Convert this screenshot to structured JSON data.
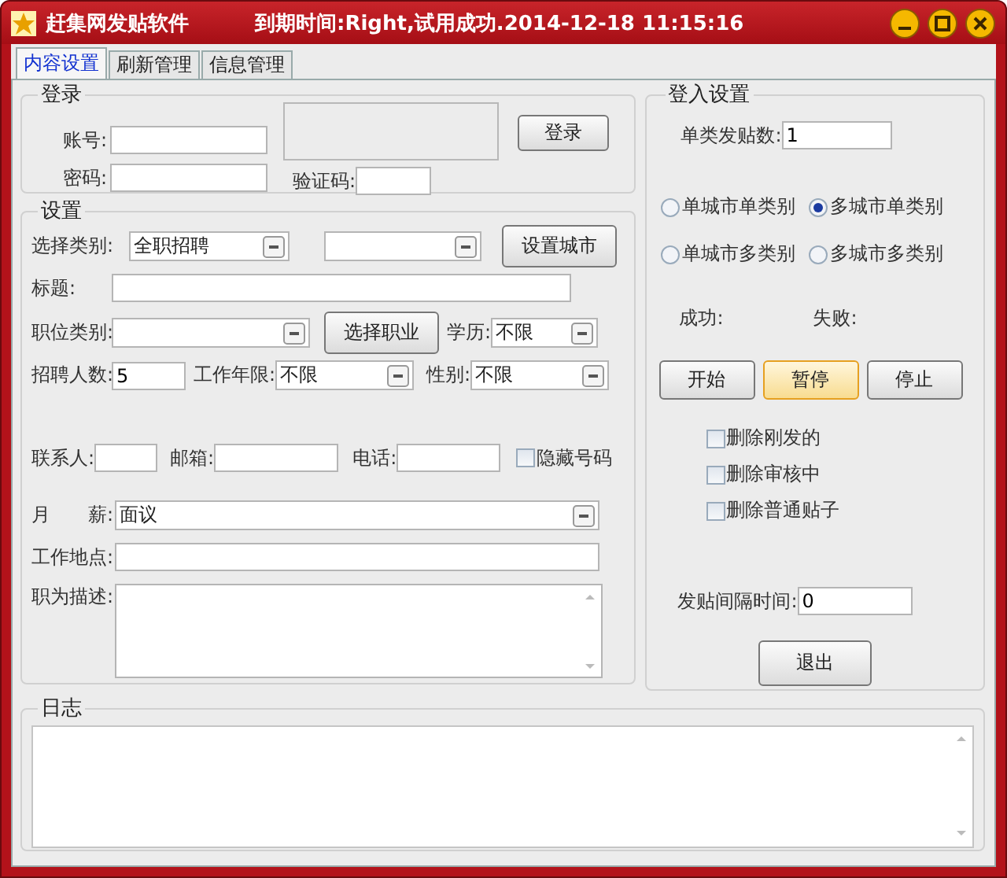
{
  "window": {
    "title": "赶集网发贴软件",
    "status": "到期时间:Right,试用成功.2014-12-18 11:15:16"
  },
  "tabs": [
    {
      "label": "内容设置",
      "selected": true
    },
    {
      "label": "刷新管理",
      "selected": false
    },
    {
      "label": "信息管理",
      "selected": false
    }
  ],
  "login": {
    "title": "登录",
    "account_label": "账号:",
    "password_label": "密码:",
    "captcha_label": "验证码:",
    "button": "登录"
  },
  "settings": {
    "title": "设置",
    "category": {
      "label": "选择类别:",
      "value": "全职招聘"
    },
    "city_button": "设置城市",
    "title_field": {
      "label": "标题:"
    },
    "position": {
      "label": "职位类别:"
    },
    "job_button": "选择职业",
    "education": {
      "label": "学历:",
      "value": "不限"
    },
    "headcount": {
      "label": "招聘人数:",
      "value": "5"
    },
    "experience": {
      "label": "工作年限:",
      "value": "不限"
    },
    "gender": {
      "label": "性别:",
      "value": "不限"
    },
    "contact": {
      "label": "联系人:"
    },
    "email": {
      "label": "邮箱:"
    },
    "phone": {
      "label": "电话:"
    },
    "hide_number": {
      "label": "隐藏号码",
      "checked": false
    },
    "salary": {
      "label": "月　　薪:",
      "value": "面议"
    },
    "location": {
      "label": "工作地点:"
    },
    "description": {
      "label": "职为描述:"
    }
  },
  "post_settings": {
    "title": "登入设置",
    "per_category": {
      "label": "单类发贴数:",
      "value": "1"
    },
    "modes": [
      {
        "label": "单城市单类别",
        "selected": false
      },
      {
        "label": "多城市单类别",
        "selected": true
      },
      {
        "label": "单城市多类别",
        "selected": false
      },
      {
        "label": "多城市多类别",
        "selected": false
      }
    ],
    "success_label": "成功:",
    "fail_label": "失败:",
    "actions": [
      {
        "label": "开始",
        "focused": false
      },
      {
        "label": "暂停",
        "focused": true
      },
      {
        "label": "停止",
        "focused": false
      }
    ],
    "options": [
      {
        "label": "删除刚发的",
        "checked": false
      },
      {
        "label": "删除审核中",
        "checked": false
      },
      {
        "label": "删除普通贴子",
        "checked": false
      }
    ],
    "interval": {
      "label": "发贴间隔时间:",
      "value": "0"
    },
    "exit_button": "退出"
  },
  "log": {
    "title": "日志"
  }
}
